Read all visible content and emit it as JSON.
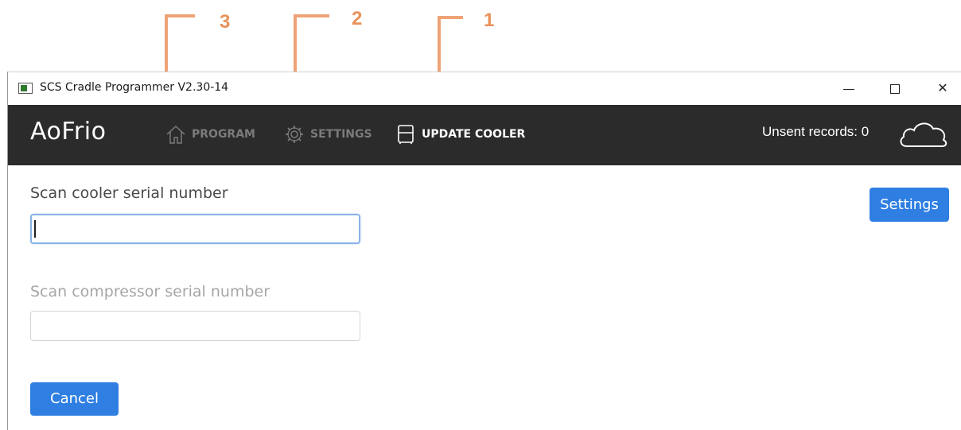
{
  "callouts": [
    "1",
    "2",
    "3"
  ],
  "window": {
    "title": "SCS Cradle Programmer V2.30-14",
    "minimize_icon": "minimize-icon",
    "maximize_icon": "maximize-icon",
    "close_icon": "close-icon",
    "close_glyph": "✕"
  },
  "nav": {
    "logo": "AoFrio",
    "items": [
      {
        "label": "PROGRAM",
        "icon": "home-icon",
        "active": false
      },
      {
        "label": "SETTINGS",
        "icon": "gear-icon",
        "active": false
      },
      {
        "label": "UPDATE COOLER",
        "icon": "cooler-icon",
        "active": true
      }
    ],
    "unsent_records": "Unsent records: 0",
    "cloud_icon": "cloud-icon"
  },
  "form": {
    "cooler_label": "Scan cooler serial number",
    "cooler_value": "",
    "compressor_label": "Scan compressor serial number",
    "compressor_value": "",
    "settings_button": "Settings",
    "cancel_button": "Cancel"
  },
  "colors": {
    "navbar": "#2b2b2b",
    "accent": "#2f7fe2",
    "callout": "#e8925a"
  }
}
